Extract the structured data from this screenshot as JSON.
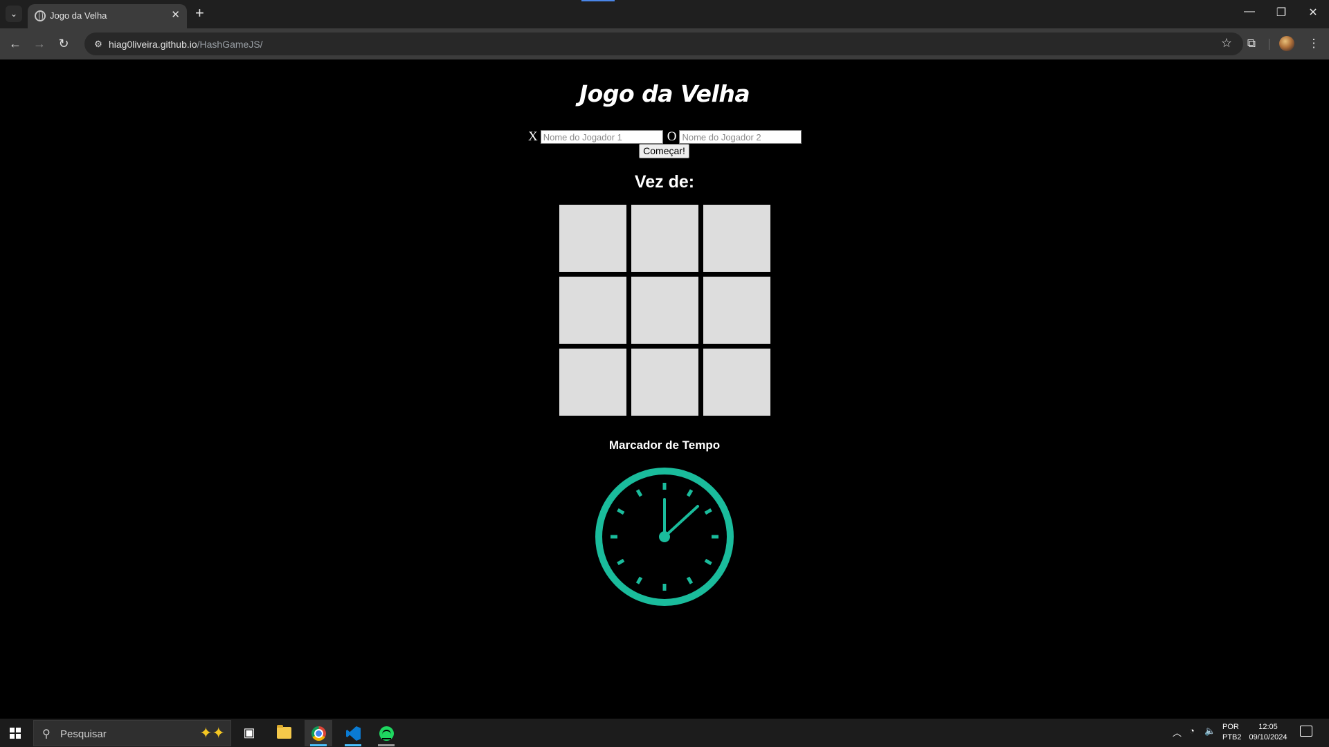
{
  "browser": {
    "tab_title": "Jogo da Velha",
    "url_host": "hiag0liveira.github.io",
    "url_path": "/HashGameJS/"
  },
  "page": {
    "title": "Jogo da Velha",
    "player_x_symbol": "X",
    "player_o_symbol": "O",
    "player1_placeholder": "Nome do Jogador 1",
    "player2_placeholder": "Nome do Jogador 2",
    "player1_value": "",
    "player2_value": "",
    "start_button": "Começar!",
    "turn_label": "Vez de:",
    "board": [
      "",
      "",
      "",
      "",
      "",
      "",
      "",
      "",
      ""
    ],
    "timer_label": "Marcador de Tempo",
    "clock_color": "#1abc9c"
  },
  "taskbar": {
    "search_placeholder": "Pesquisar",
    "lang_top": "POR",
    "lang_bottom": "PTB2",
    "time": "12:05",
    "date": "09/10/2024"
  },
  "icons": [
    "tab-list-icon",
    "globe-icon",
    "close-icon",
    "plus-icon",
    "minimize-icon",
    "restore-icon",
    "back-icon",
    "forward-icon",
    "reload-icon",
    "site-info-icon",
    "star-icon",
    "extensions-icon",
    "menu-icon",
    "windows-icon",
    "search-icon",
    "task-view-icon",
    "file-explorer-icon",
    "chrome-icon",
    "vscode-icon",
    "spotify-icon",
    "chevron-up-icon",
    "network-icon",
    "volume-icon",
    "notification-icon"
  ]
}
